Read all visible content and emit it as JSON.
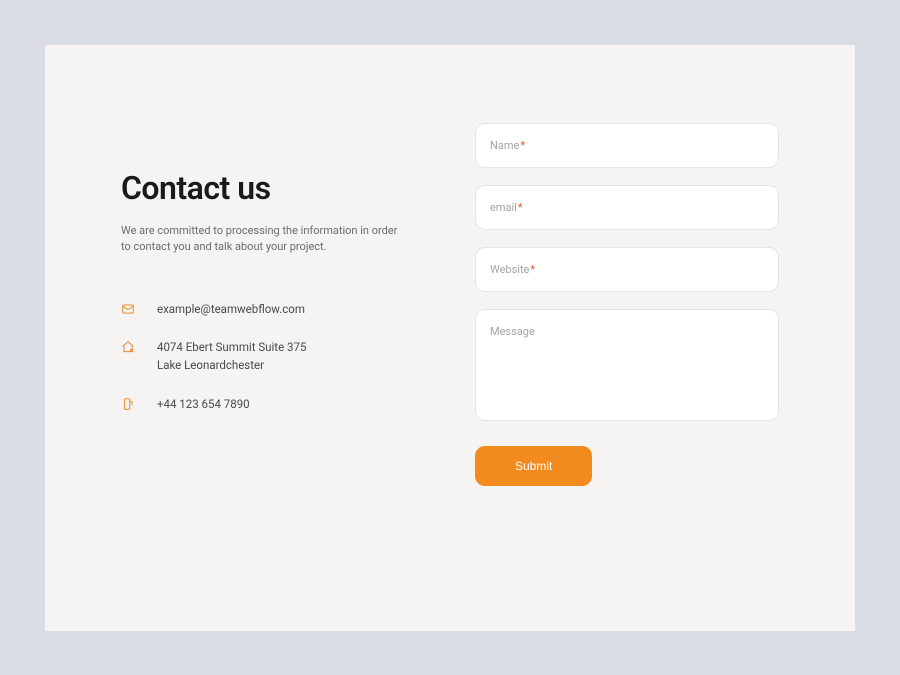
{
  "heading": "Contact us",
  "description": "We are committed to processing the information in order to contact you and talk about your project.",
  "info": {
    "email": "example@teamwebflow.com",
    "address_line1": "4074 Ebert Summit Suite 375",
    "address_line2": "Lake Leonardchester",
    "phone": "+44 123 654 7890"
  },
  "form": {
    "name_placeholder": "Name",
    "email_placeholder": "email",
    "website_placeholder": "Website",
    "message_placeholder": "Message",
    "submit_label": "Submit"
  }
}
